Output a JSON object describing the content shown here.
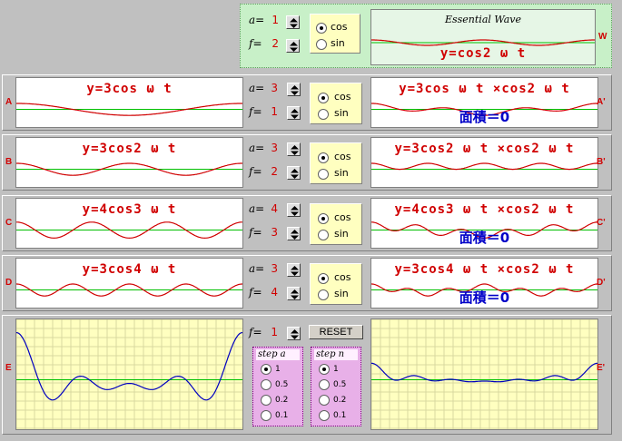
{
  "top": {
    "a_label": "a=",
    "a_value": "1",
    "f_label": "f=",
    "f_value": "2",
    "cos_label": "cos",
    "sin_label": "sin",
    "selected": "cos",
    "essential_title": "Essential Wave",
    "formula": "y=cos2 ω t",
    "w_label": "W",
    "wave": {
      "a": 1,
      "f": 2
    }
  },
  "rows": [
    {
      "id": "A",
      "label": "A",
      "label2": "A'",
      "formula": "y=3cos ω t",
      "product": "y=3cos ω t ×cos2 ω t",
      "area": "面積＝0",
      "a_label": "a=",
      "a_value": "3",
      "f_label": "f=",
      "f_value": "1",
      "cos_label": "cos",
      "sin_label": "sin",
      "selected": "cos",
      "wave": {
        "a": 3,
        "f": 1
      }
    },
    {
      "id": "B",
      "label": "B",
      "label2": "B'",
      "formula": "y=3cos2 ω t",
      "product": "y=3cos2 ω t ×cos2 ω t",
      "area": "",
      "a_label": "a=",
      "a_value": "3",
      "f_label": "f=",
      "f_value": "2",
      "cos_label": "cos",
      "sin_label": "sin",
      "selected": "cos",
      "wave": {
        "a": 3,
        "f": 2
      }
    },
    {
      "id": "C",
      "label": "C",
      "label2": "C'",
      "formula": "y=4cos3 ω t",
      "product": "y=4cos3 ω t ×cos2 ω t",
      "area": "面積＝0",
      "a_label": "a=",
      "a_value": "4",
      "f_label": "f=",
      "f_value": "3",
      "cos_label": "cos",
      "sin_label": "sin",
      "selected": "cos",
      "wave": {
        "a": 4,
        "f": 3
      }
    },
    {
      "id": "D",
      "label": "D",
      "label2": "D'",
      "formula": "y=3cos4 ω t",
      "product": "y=3cos4 ω t ×cos2 ω t",
      "area": "面積＝0",
      "a_label": "a=",
      "a_value": "3",
      "f_label": "f=",
      "f_value": "4",
      "cos_label": "cos",
      "sin_label": "sin",
      "selected": "cos",
      "wave": {
        "a": 3,
        "f": 4
      }
    }
  ],
  "rowE": {
    "label": "E",
    "label2": "E'",
    "f_label": "f=",
    "f_value": "1",
    "reset_label": "RESET",
    "step_a_title": "step a",
    "step_n_title": "step n",
    "step_a_options": [
      "1",
      "0.5",
      "0.2",
      "0.1"
    ],
    "step_n_options": [
      "1",
      "0.5",
      "0.2",
      "0.1"
    ],
    "step_a_selected": "1",
    "step_n_selected": "1"
  },
  "colors": {
    "curve": "#d00000",
    "axis": "#00c000",
    "blue_curve": "#0000c0",
    "grid": "#ffffc0",
    "grid_line": "#d8d8a0"
  }
}
